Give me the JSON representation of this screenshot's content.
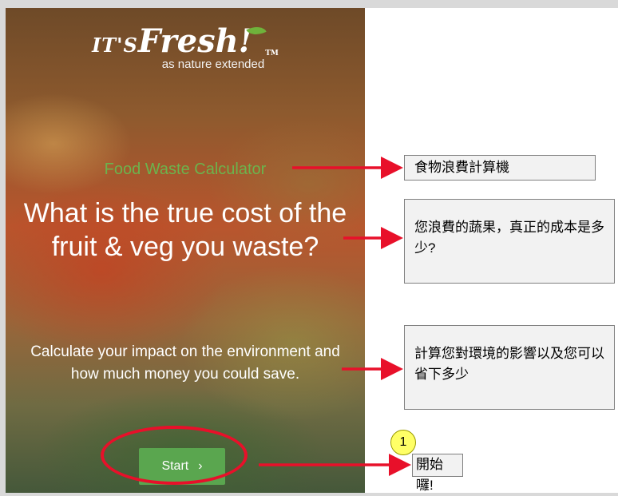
{
  "app": {
    "logo": {
      "brand_its": "IT'S",
      "brand_fresh": "Fresh!",
      "tm": "TM",
      "tagline": "as nature extended"
    },
    "section_label": "Food Waste Calculator",
    "headline": "What is the true cost of the fruit & veg you waste?",
    "subtext": "Calculate your impact on the environment and how much money you could save.",
    "start_button": {
      "label": "Start",
      "icon": "chevron-right-icon",
      "color": "#5aa64f"
    }
  },
  "annotations": {
    "callouts": [
      {
        "text": "食物浪費計算機"
      },
      {
        "text": "您浪費的蔬果，真正的成本是多少?"
      },
      {
        "text": "計算您對環境的影響以及您可以省下多少"
      },
      {
        "text": "開始囉!"
      }
    ],
    "step_badge": "1",
    "arrow_color": "#e8102a",
    "highlight_color": "#e8102a"
  }
}
